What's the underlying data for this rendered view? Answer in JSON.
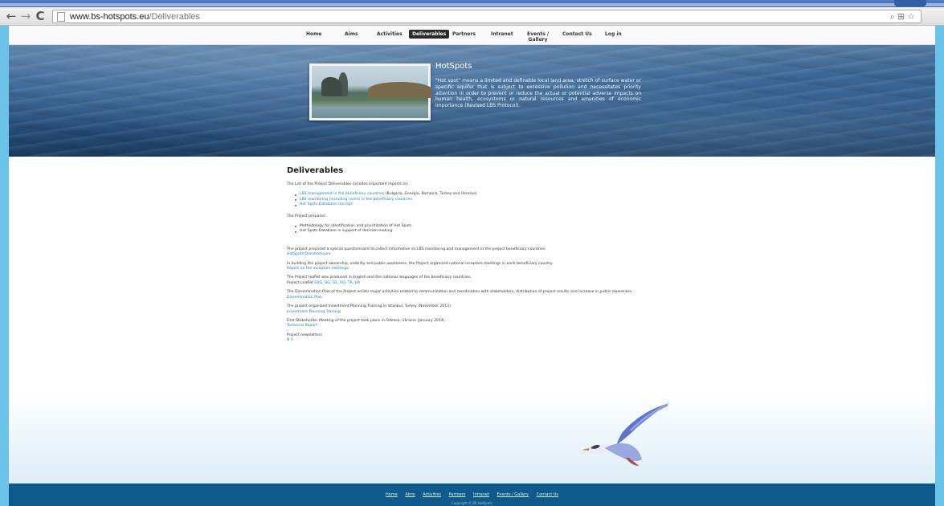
{
  "browser": {
    "url_host": "www.bs-hotspots.eu",
    "url_path": "/Deliverables",
    "back": "←",
    "forward": "→",
    "reload": "C"
  },
  "nav": {
    "items": [
      {
        "label": "Home",
        "sub": ""
      },
      {
        "label": "Aims",
        "sub": ""
      },
      {
        "label": "Activities",
        "sub": ""
      },
      {
        "label": "Deliverables",
        "sub": ""
      },
      {
        "label": "Partners",
        "sub": ""
      },
      {
        "label": "Intranet",
        "sub": ""
      },
      {
        "label": "Events /",
        "sub": "Gallery"
      },
      {
        "label": "Contact Us",
        "sub": ""
      },
      {
        "label": "Log in",
        "sub": ""
      }
    ]
  },
  "banner": {
    "title": "HotSpots",
    "text": "\"Hot spot\" means a limited and definable local land area, stretch of surface water or specific aquifer that is subject to excessive pollution and necessitates priority attention in order to prevent or reduce the actual or potential adverse impacts on human health, ecosystems or natural resources and amenities of economic importance (Revised LBS Protocol)."
  },
  "content": {
    "heading": "Deliverables",
    "intro": "The List of the Project Deliverables includes important reports on:",
    "reports": [
      {
        "link": "LBS management in the beneficiary countries",
        "rest": " (Bulgaria, Georgia, Romania, Turkey and Ukraine)"
      },
      {
        "link": "LBS monitoring (including rivers) in the beneficiary countries",
        "rest": ""
      },
      {
        "link": "Hot Spots Database concept",
        "rest": ""
      }
    ],
    "prepares_intro": "The Project prepares:",
    "prepares": [
      "Methodology for identification and prioritization of Hot Spots",
      "Hot Spots Database in support of decision-making"
    ],
    "para1": "The project prepared a special questionnaire to collect information on LBS monitoring and management in the project beneficiary countries.",
    "para1_link": "HotSpots Questionnaire",
    "para2": "In building the project ownership, visibility and public awareness, the Project organized national inception meetings in each beneficiary country.",
    "para2_link": "Report on the inception meetings",
    "para3": "The Project leaflet was produced in English and the national languages of the beneficiary countries.",
    "para3_prefix": "Project Leaflet ",
    "para3_links": "ENG, BG, GE, RO, TR, UA",
    "para4": "The Dissemination Plan of the Project enlists major activities related to communication and coordination with stakeholders, distribution of project results and increase in public awareness.",
    "para4_link": "Dissemination Plan",
    "para5": "The project organized Investment Planning Training in Istanbul, Turkey (November 2013).",
    "para5_link": "Investment Planning Training",
    "para6": "First Stakeholder Meeting of the project took place in Odessa, Ukraine (January 2014).",
    "para6_link": "Technical Report",
    "para7": "Project newsletters",
    "para7_link": "N 1"
  },
  "footer": {
    "links": [
      "Home",
      "Aims",
      "Activities",
      "Partners",
      "Intranet",
      "Events / Gallery",
      "Contact Us"
    ],
    "copyright": "Copyright © BS HotSpots"
  },
  "colors": {
    "accent_link": "#1b7bbf",
    "footer_bg": "#0e5a8c",
    "page_bg": "#6cc3ea"
  }
}
